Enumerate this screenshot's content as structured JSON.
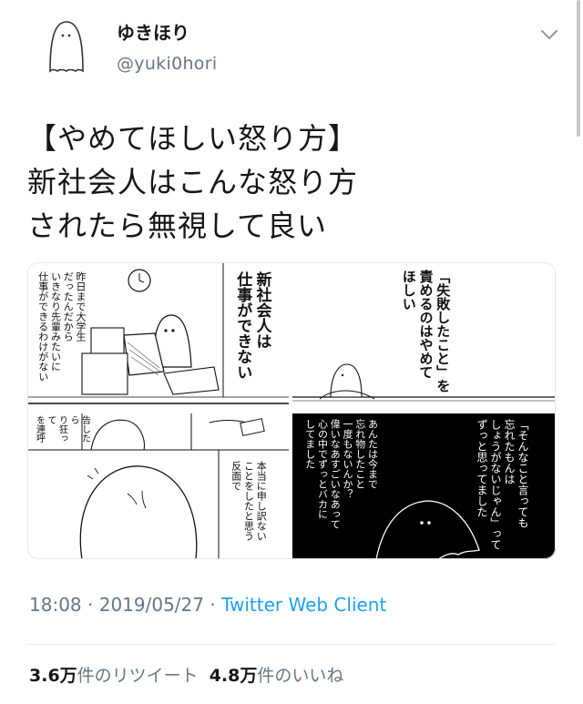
{
  "user": {
    "display_name": "ゆきほり",
    "handle": "@yuki0hori"
  },
  "tweet": {
    "lines": [
      "【やめてほしい怒り方】",
      "新社会人はこんな怒り方",
      "されたら無視して良い"
    ]
  },
  "comic": {
    "panel1": {
      "caption": "新社会人は\n仕事ができない",
      "speech": "昨日まで大学生\nだったんだから\nいきなり先輩みたいに\n仕事ができるわけがない"
    },
    "panel2": {
      "caption": "「失敗したこと」を\n責めるのはやめて\nほしい"
    },
    "panel3": {
      "left": "告したら\nり狂って\nを連呼",
      "right": "本当に申し訳ない\nことをしたと思う\n反面で"
    },
    "panel4": {
      "right": "「そんなこと言っても\n忘れたもんは\nしょうがないじゃん」って\nずっと思ってました",
      "left": "あんたは今まで\n忘れ物したこと\n一度もないんか？\n偉いなあすごいなあって\n心の中でずっとバカに\nしてました"
    }
  },
  "meta": {
    "time": "18:08",
    "sep1": " · ",
    "date": "2019/05/27",
    "sep2": " · ",
    "client": "Twitter Web Client"
  },
  "stats": {
    "retweets_count": "3.6万",
    "retweets_label": "件のリツイート",
    "likes_count": "4.8万",
    "likes_label": "件のいいね"
  },
  "icons": [
    "ghost-avatar-icon",
    "chevron-down-icon"
  ]
}
